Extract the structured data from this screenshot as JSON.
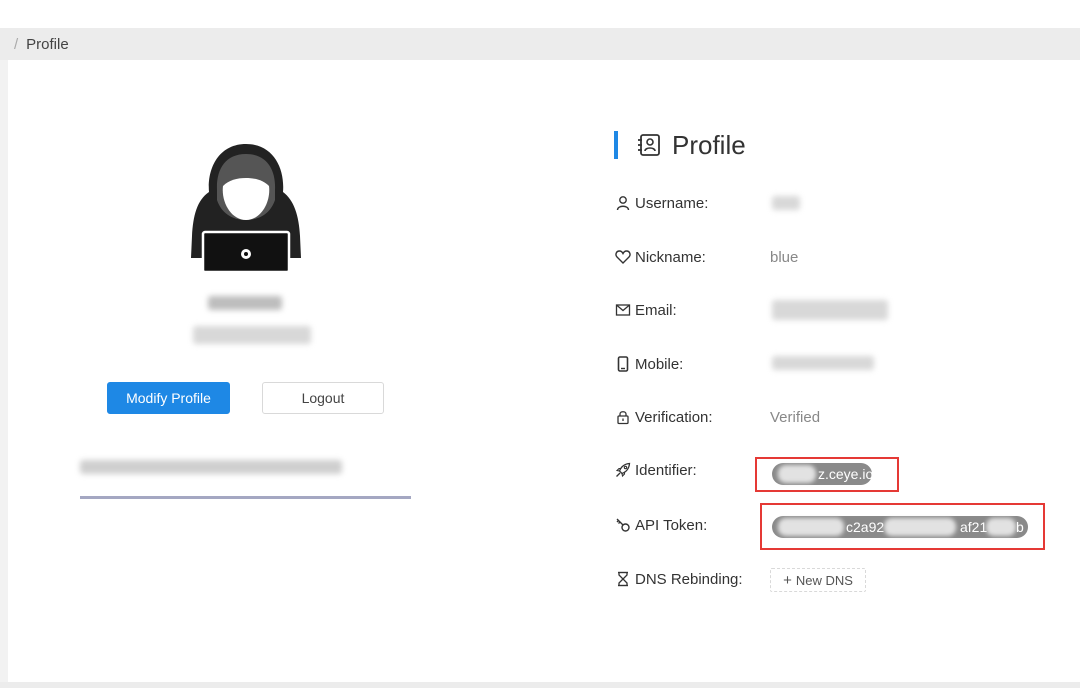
{
  "breadcrumb": {
    "separator": "/",
    "current": "Profile"
  },
  "left": {
    "modify_label": "Modify Profile",
    "logout_label": "Logout"
  },
  "profile": {
    "title": "Profile",
    "rows": [
      {
        "key": "username",
        "label": "Username:",
        "icon": "user-icon",
        "value": ""
      },
      {
        "key": "nickname",
        "label": "Nickname:",
        "icon": "heart-icon",
        "value": "blue"
      },
      {
        "key": "email",
        "label": "Email:",
        "icon": "mail-icon",
        "value": ""
      },
      {
        "key": "mobile",
        "label": "Mobile:",
        "icon": "mobile-icon",
        "value": ""
      },
      {
        "key": "verification",
        "label": "Verification:",
        "icon": "lock-icon",
        "value": "Verified"
      },
      {
        "key": "identifier",
        "label": "Identifier:",
        "icon": "rocket-icon",
        "value": "z.ceye.io"
      },
      {
        "key": "api_token",
        "label": "API Token:",
        "icon": "key-icon",
        "value_parts": [
          "c2a92",
          "af21",
          "b"
        ]
      },
      {
        "key": "dns_rebinding",
        "label": "DNS Rebinding:",
        "icon": "hourglass-icon",
        "action": "New DNS"
      }
    ]
  },
  "colors": {
    "accent": "#1e88e5",
    "highlight_box": "#e53935",
    "pill": "#8a8a8a"
  }
}
